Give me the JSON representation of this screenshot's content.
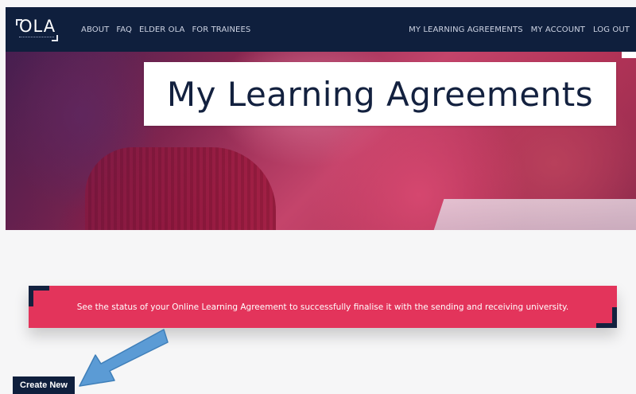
{
  "brand": {
    "logo_text": "OLA",
    "logo_icon": "ola-logo"
  },
  "nav": {
    "left": [
      "ABOUT",
      "FAQ",
      "ELDER OLA",
      "FOR TRAINEES"
    ],
    "right": [
      "MY LEARNING AGREEMENTS",
      "MY ACCOUNT",
      "LOG OUT"
    ]
  },
  "hero": {
    "title": "My Learning Agreements",
    "image": "students-photo"
  },
  "info": {
    "text": "See the status of your Online Learning Agreement to successfully finalise it with the sending and receiving university."
  },
  "actions": {
    "create_new_label": "Create New"
  },
  "annotation": {
    "arrow_icon": "pointer-arrow",
    "arrow_color": "#5b9bd5"
  },
  "colors": {
    "navy": "#0f1f3d",
    "accent": "#e3345b",
    "background": "#f6f6f7"
  }
}
